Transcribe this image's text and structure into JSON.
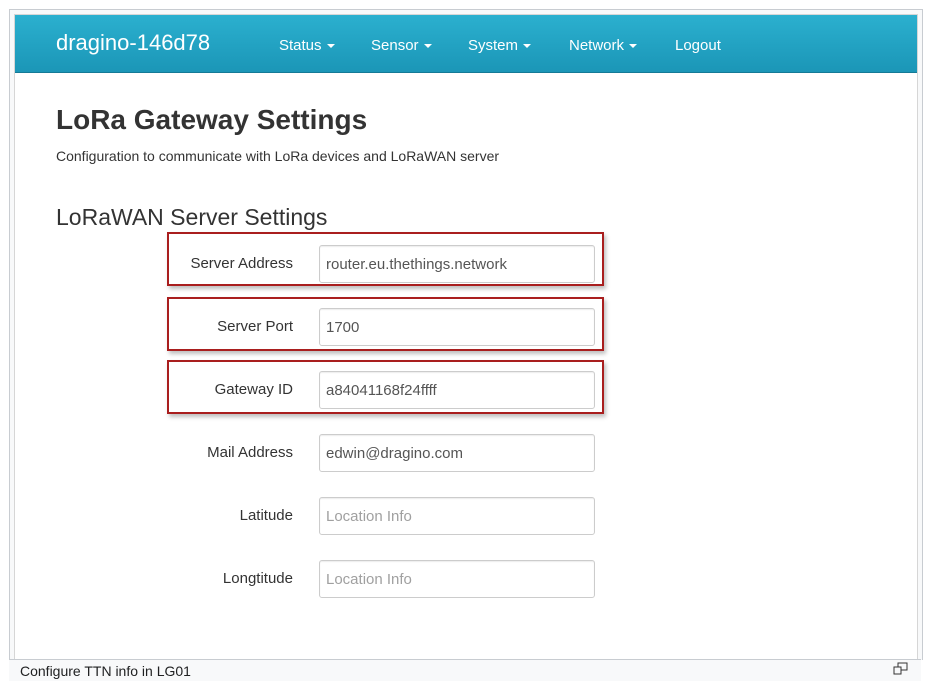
{
  "navbar": {
    "brand": "dragino-146d78",
    "items": [
      {
        "label": "Status",
        "has_dropdown": true
      },
      {
        "label": "Sensor",
        "has_dropdown": true
      },
      {
        "label": "System",
        "has_dropdown": true
      },
      {
        "label": "Network",
        "has_dropdown": true
      },
      {
        "label": "Logout",
        "has_dropdown": false
      }
    ]
  },
  "page": {
    "title": "LoRa Gateway Settings",
    "description": "Configuration to communicate with LoRa devices and LoRaWAN server"
  },
  "section": {
    "title": "LoRaWAN Server Settings"
  },
  "form": {
    "fields": [
      {
        "label": "Server Address",
        "value": "router.eu.thethings.network",
        "placeholder": ""
      },
      {
        "label": "Server Port",
        "value": "1700",
        "placeholder": ""
      },
      {
        "label": "Gateway ID",
        "value": "a84041168f24ffff",
        "placeholder": ""
      },
      {
        "label": "Mail Address",
        "value": "edwin@dragino.com",
        "placeholder": ""
      },
      {
        "label": "Latitude",
        "value": "",
        "placeholder": "Location Info"
      },
      {
        "label": "Longtitude",
        "value": "",
        "placeholder": "Location Info"
      }
    ]
  },
  "caption": {
    "text": "Configure TTN info in LG01",
    "magnify_icon": "magnify-icon"
  },
  "colors": {
    "navbar": "#1fa3c4",
    "highlight": "#a91e1e"
  }
}
